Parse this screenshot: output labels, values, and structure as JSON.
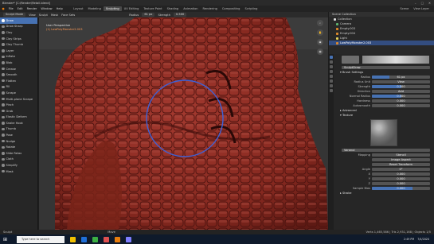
{
  "window": {
    "title": "Blender* [C:\\Render\\Retail.blend]",
    "controls": [
      "–",
      "□",
      "✕"
    ]
  },
  "menubar": {
    "menus": [
      "File",
      "Edit",
      "Render",
      "Window",
      "Help"
    ],
    "workspaces": [
      "Layout",
      "Modeling",
      "Sculpting",
      "UV Editing",
      "Texture Paint",
      "Shading",
      "Animation",
      "Rendering",
      "Compositing",
      "Scripting"
    ],
    "active_workspace": "Sculpting",
    "scene": "Scene",
    "view_layer": "View Layer"
  },
  "header": {
    "mode": "Sculpt Mode",
    "menus": [
      "View",
      "Sculpt",
      "Mask",
      "Face Sets"
    ],
    "radius_label": "Radius",
    "radius": "61 px",
    "strength_label": "Strength",
    "strength": "0.500"
  },
  "toolbar": {
    "tools": [
      "Draw",
      "Draw Sharp",
      "Clay",
      "Clay Strips",
      "Clay Thumb",
      "Layer",
      "Inflate",
      "Blob",
      "Crease",
      "Smooth",
      "Flatten",
      "Fill",
      "Scrape",
      "Multi-plane Scrape",
      "Pinch",
      "Grab",
      "Elastic Deform",
      "Snake Hook",
      "Thumb",
      "Pose",
      "Nudge",
      "Rotate",
      "Slide Relax",
      "Cloth",
      "Simplify",
      "Mask"
    ],
    "active_index": 0
  },
  "viewport": {
    "line1": "User Perspective",
    "line2": "(1) LowPolyMonster2.003",
    "colors": {
      "skin": "#8c2c24",
      "background": "#3a3a3a",
      "brush_circle": "#3d62d8"
    }
  },
  "outliner": {
    "title": "Scene Collection",
    "rows": [
      "Collection",
      "Camera",
      "Empty.003",
      "Empty.004",
      "Light",
      "LowPolyMonster2.003"
    ],
    "selected_index": 5
  },
  "properties": {
    "brush_name": "SculptDraw",
    "section_brush": "Brush Settings",
    "fields": [
      {
        "label": "Radius",
        "value": "61 px",
        "fill": 0.3
      },
      {
        "label": "Radius Unit",
        "value": "View",
        "fill": 0.0
      },
      {
        "label": "Strength",
        "value": "0.500",
        "fill": 0.5
      },
      {
        "label": "Direction",
        "value": "Add",
        "fill": 0.0
      },
      {
        "label": "Normal Radius",
        "value": "0.500",
        "fill": 0.5
      },
      {
        "label": "Hardness",
        "value": "0.000",
        "fill": 0.0
      },
      {
        "label": "Autosmooth",
        "value": "0.000",
        "fill": 0.0
      }
    ],
    "section_advanced": "Advanced",
    "section_texture": "Texture",
    "texture_name": "Voronoi",
    "mapping_label": "Mapping",
    "mapping": "Stencil",
    "tex_fields": [
      {
        "label": "Image Aspect",
        "value": "",
        "fill": 0.0
      },
      {
        "label": "Reset Transform",
        "value": "",
        "fill": 0.0
      },
      {
        "label": "Angle",
        "value": "0°",
        "fill": 0.0
      },
      {
        "label": "X",
        "value": "0.000",
        "fill": 0.0
      },
      {
        "label": "Y",
        "value": "0.000",
        "fill": 0.0
      },
      {
        "label": "Z",
        "value": "0.000",
        "fill": 0.0
      },
      {
        "label": "Sample Bias",
        "value": "0.000",
        "fill": 0.7
      }
    ],
    "section_stroke": "Stroke"
  },
  "statusbar": {
    "left": "Sculpt",
    "middle": "Move",
    "right": "Verts 1,465,586 | Tris 2,931,168 | Objects 1/5"
  },
  "taskbar": {
    "search_placeholder": "Type here to search",
    "time": "2:49 PM",
    "date": "7/4/2020",
    "icon_colors": [
      "#f0c000",
      "#1f6fd8",
      "#3cb043",
      "#e05050",
      "#e87d0d",
      "#7f7fff"
    ]
  }
}
